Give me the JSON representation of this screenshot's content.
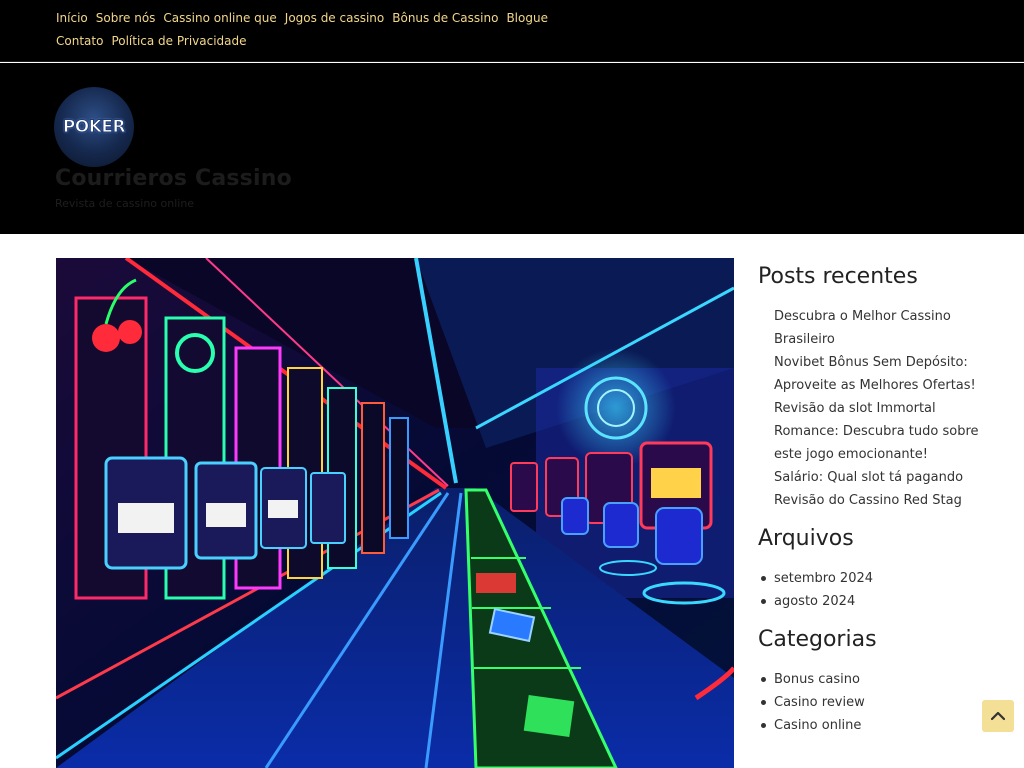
{
  "nav": {
    "items": [
      "Início",
      "Sobre nós",
      "Cassino online que",
      "Jogos de cassino",
      "Bônus de Cassino",
      "Blogue",
      "Contato",
      "Política de Privacidade"
    ]
  },
  "header": {
    "logo_text": "POKER",
    "site_title": "Courrieros Cassino",
    "site_description": "Revista de cassino online"
  },
  "sidebar": {
    "recent_posts": {
      "title": "Posts recentes",
      "items": [
        "Descubra o Melhor Cassino Brasileiro",
        "Novibet Bônus Sem Depósito: Aproveite as Melhores Ofertas!",
        "Revisão da slot Immortal Romance: Descubra tudo sobre este jogo emocionante!",
        "Salário: Qual slot tá pagando",
        "Revisão do Cassino Red Stag"
      ]
    },
    "archives": {
      "title": "Arquivos",
      "items": [
        "setembro 2024",
        "agosto 2024"
      ]
    },
    "categories": {
      "title": "Categorias",
      "items": [
        "Bonus casino",
        "Casino review",
        "Casino online"
      ]
    }
  },
  "colors": {
    "nav_link": "#f2d78a",
    "header_bg": "#000000",
    "back_to_top_bg": "#f4df97"
  },
  "icons": {
    "back_to_top": "chevron-up-icon"
  }
}
